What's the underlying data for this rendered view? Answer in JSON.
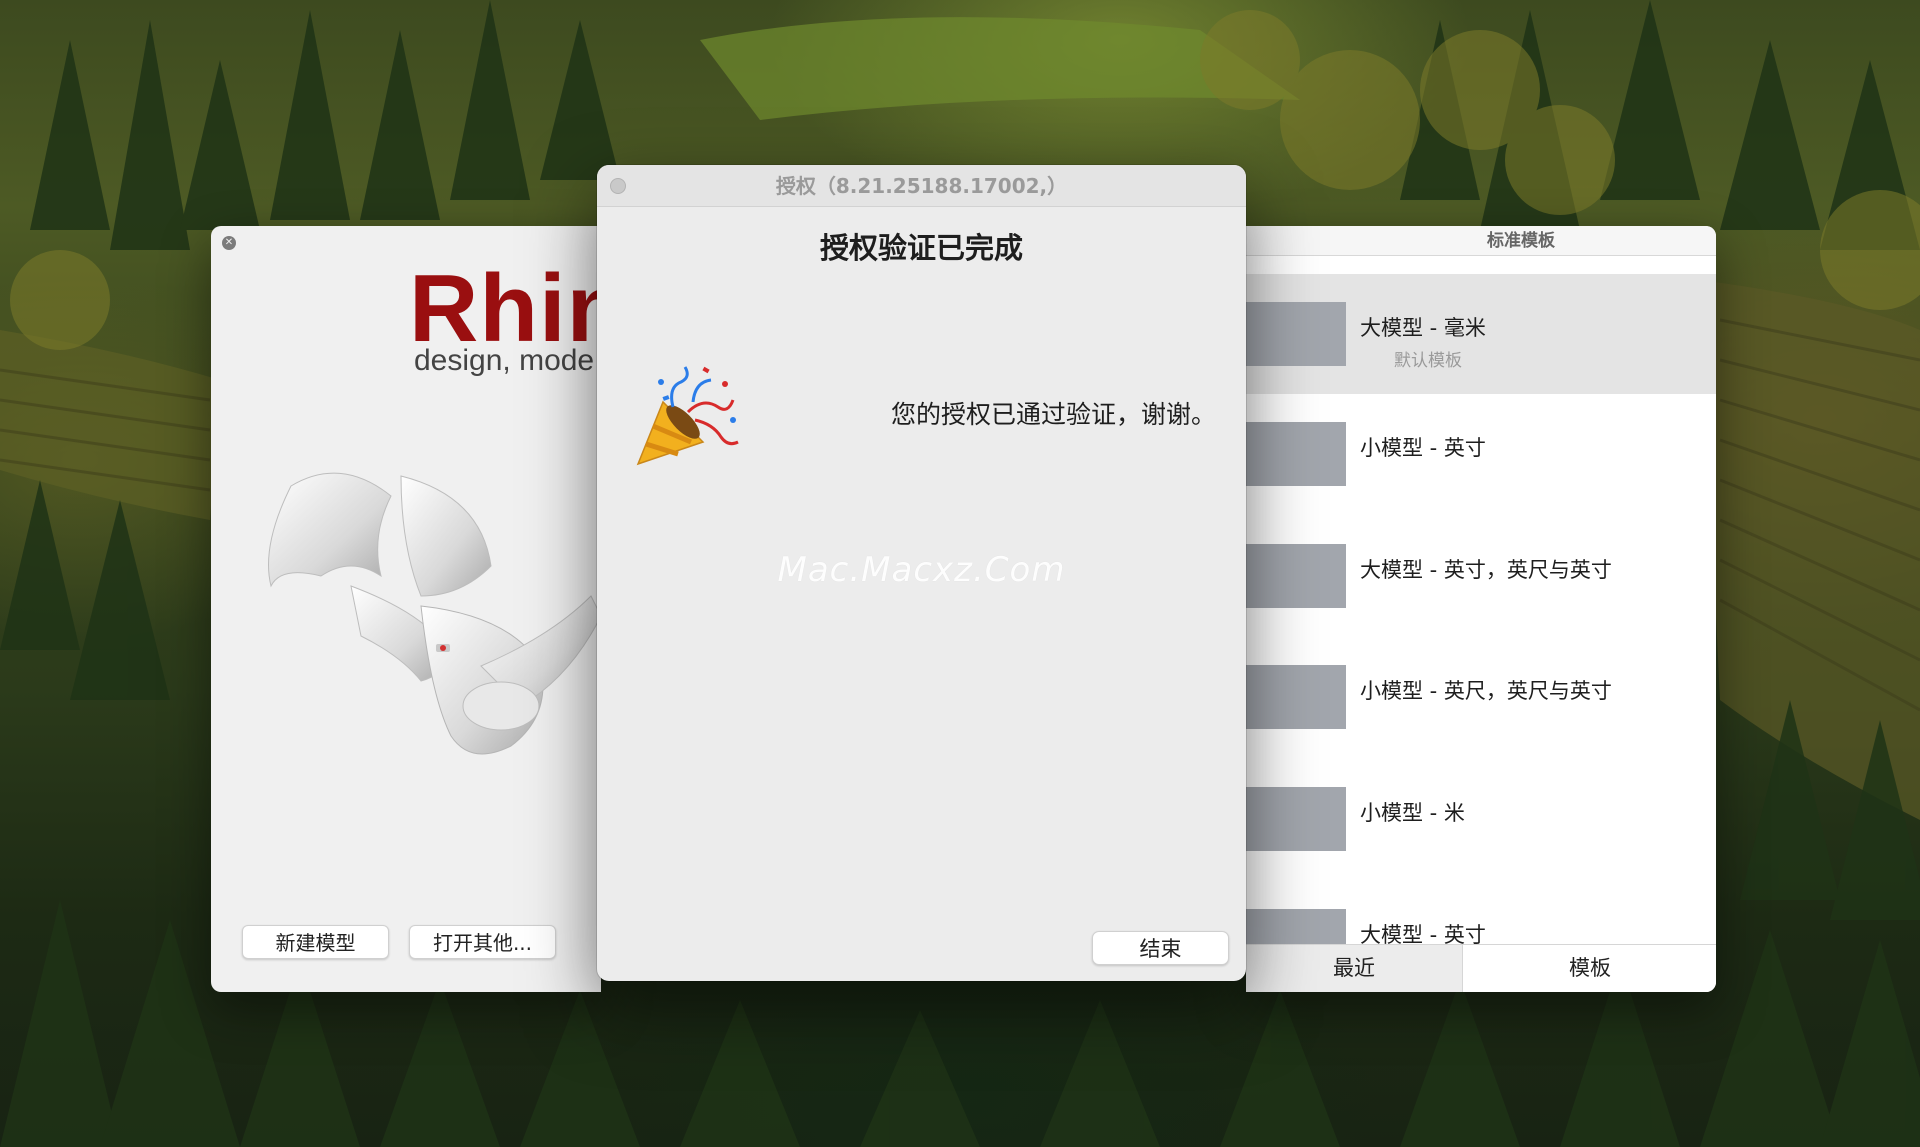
{
  "rhino_window": {
    "logo_text": "Rhin",
    "tagline": "design, mode",
    "new_model_label": "新建模型",
    "open_other_label": "打开其他..."
  },
  "license_dialog": {
    "title": "授权（8.21.25188.17002,）",
    "heading": "授权验证已完成",
    "message": "您的授权已通过验证，谢谢。",
    "watermark": "Mac.Macxz.Com",
    "finish_label": "结束",
    "icon": "party-popper-icon"
  },
  "templates_panel": {
    "header": "标准模板",
    "items": [
      {
        "name": "大模型 - 毫米",
        "subtitle": "默认模板"
      },
      {
        "name": "小模型 - 英寸",
        "subtitle": ""
      },
      {
        "name": "大模型 - 英寸，英尺与英寸",
        "subtitle": ""
      },
      {
        "name": "小模型 - 英尺，英尺与英寸",
        "subtitle": ""
      },
      {
        "name": "小模型 - 米",
        "subtitle": ""
      },
      {
        "name": "大模型 - 英寸",
        "subtitle": ""
      }
    ],
    "tabs": [
      {
        "label": "最近",
        "active": false
      },
      {
        "label": "模板",
        "active": true
      }
    ]
  },
  "colors": {
    "rhino_red": "#9a0f10",
    "selected_row": "#e4e4e4",
    "thumbnail_gray": "#a2a6ad"
  }
}
